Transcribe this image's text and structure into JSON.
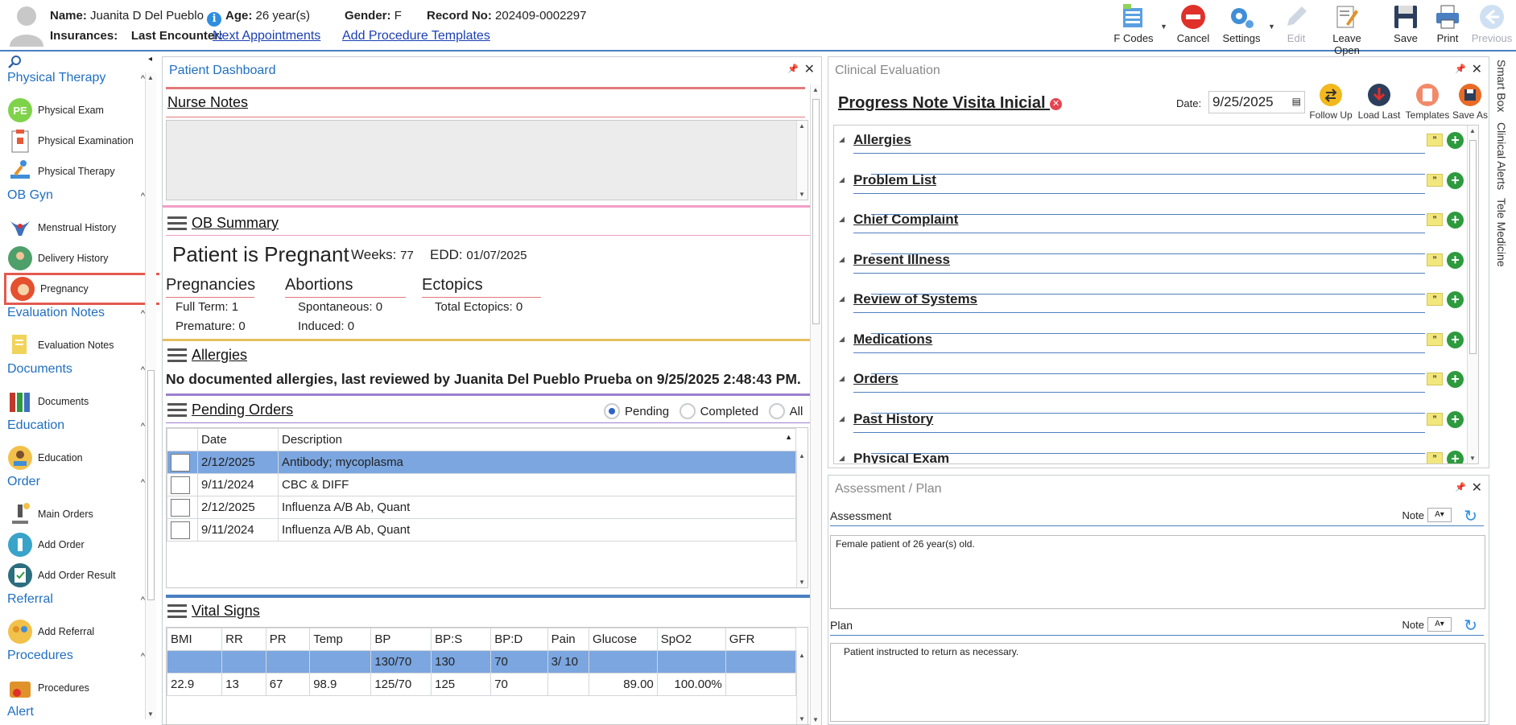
{
  "header": {
    "name_label": "Name:",
    "name": "Juanita D Del Pueblo",
    "info_icon": "i",
    "age_label": "Age:",
    "age": "26 year(s)",
    "gender_label": "Gender:",
    "gender": "F",
    "record_label": "Record No:",
    "record": "202409-0002297",
    "insurances_label": "Insurances:",
    "last_encounter_label": "Last Encounter:",
    "next_appointments": "Next Appointments",
    "add_procedure_templates": "Add Procedure Templates"
  },
  "toolbar": {
    "fcodes": "F Codes",
    "cancel": "Cancel",
    "settings": "Settings",
    "edit": "Edit",
    "leave_open": "Leave Open",
    "save": "Save",
    "print": "Print",
    "previous": "Previous"
  },
  "sidebar": {
    "sections": [
      {
        "title": "Physical Therapy",
        "items": [
          "Physical Exam",
          "Physical Examination",
          "Physical Therapy"
        ]
      },
      {
        "title": "OB Gyn",
        "items": [
          "Menstrual History",
          "Delivery History",
          "Pregnancy"
        ]
      },
      {
        "title": "Evaluation Notes",
        "items": [
          "Evaluation Notes"
        ]
      },
      {
        "title": "Documents",
        "items": [
          "Documents"
        ]
      },
      {
        "title": "Education",
        "items": [
          "Education"
        ]
      },
      {
        "title": "Order",
        "items": [
          "Main Orders",
          "Add Order",
          "Add Order Result"
        ]
      },
      {
        "title": "Referral",
        "items": [
          "Add Referral"
        ]
      },
      {
        "title": "Procedures",
        "items": [
          "Procedures"
        ]
      },
      {
        "title": "Alert",
        "items": []
      }
    ],
    "pe_badge": "PE"
  },
  "dashboard": {
    "title": "Patient Dashboard",
    "nurse_notes": "Nurse Notes",
    "ob_summary": "OB Summary",
    "pregnant_text": "Patient is Pregnant",
    "weeks_label": "Weeks:",
    "weeks": "77",
    "edd_label": "EDD:",
    "edd": "01/07/2025",
    "pregnancies_label": "Pregnancies",
    "full_term": "Full Term: 1",
    "premature": "Premature: 0",
    "abortions_label": "Abortions",
    "spontaneous": "Spontaneous: 0",
    "induced": "Induced: 0",
    "ectopics_label": "Ectopics",
    "total_ectopics": "Total Ectopics: 0",
    "allergies_label": "Allergies",
    "allergies_text": "No documented allergies, last reviewed by Juanita Del Pueblo Prueba on 9/25/2025 2:48:43 PM.",
    "pending_orders_label": "Pending Orders",
    "radio_pending": "Pending",
    "radio_completed": "Completed",
    "radio_all": "All",
    "orders_columns": [
      "Date",
      "Description"
    ],
    "orders": [
      {
        "date": "2/12/2025",
        "description": "Antibody; mycoplasma"
      },
      {
        "date": "9/11/2024",
        "description": "CBC & DIFF"
      },
      {
        "date": "2/12/2025",
        "description": "Influenza A/B Ab, Quant"
      },
      {
        "date": "9/11/2024",
        "description": "Influenza A/B Ab, Quant"
      }
    ],
    "vitals_label": "Vital Signs",
    "vitals_columns": [
      "BMI",
      "RR",
      "PR",
      "Temp",
      "BP",
      "BP:S",
      "BP:D",
      "Pain",
      "Glucose",
      "SpO2",
      "GFR"
    ],
    "vitals_rows": [
      [
        "",
        "",
        "",
        "",
        "130/70",
        "130",
        "70",
        "3/ 10",
        "",
        "",
        ""
      ],
      [
        "22.9",
        "13",
        "67",
        "98.9",
        "125/70",
        "125",
        "70",
        "",
        "89.00",
        "100.00%",
        ""
      ]
    ]
  },
  "clinical": {
    "title": "Clinical Evaluation",
    "note_title": "Progress Note Visita Inicial",
    "date_label": "Date:",
    "date_value": "9/25/2025",
    "actions": [
      "Follow Up",
      "Load Last",
      "Templates",
      "Save As"
    ],
    "quote_glyph": "”",
    "plus_glyph": "+",
    "sections": [
      "Allergies",
      "Problem List",
      "Chief Complaint",
      "Present Illness",
      "Review of Systems",
      "Medications",
      "Orders",
      "Past History",
      "Physical Exam"
    ]
  },
  "assessment": {
    "title": "Assessment / Plan",
    "assessment_label": "Assessment",
    "note_label": "Note",
    "assessment_text": "Female patient of 26 year(s) old.",
    "plan_label": "Plan",
    "plan_text": "Patient instructed to return as necessary."
  },
  "side_tabs": [
    "Smart Box",
    "Clinical Alerts",
    "Tele Medicine"
  ]
}
